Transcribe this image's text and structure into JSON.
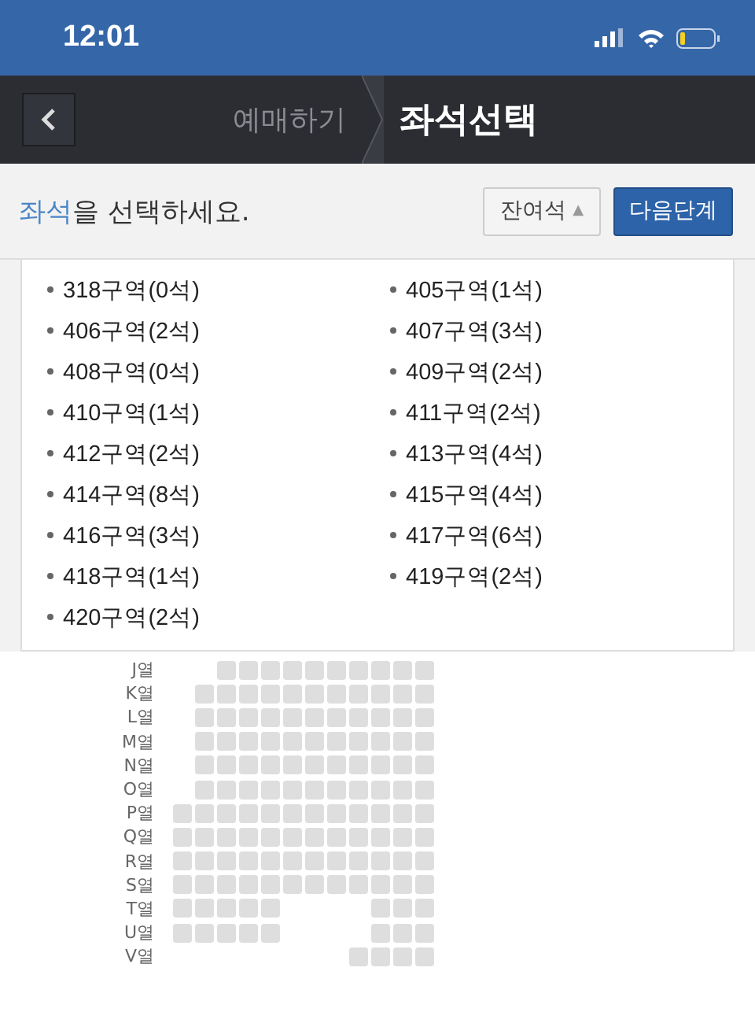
{
  "status_bar": {
    "time": "12:01"
  },
  "nav": {
    "steps": [
      {
        "label": "예매하기",
        "selected": false
      },
      {
        "label": "좌석선택",
        "selected": true
      }
    ]
  },
  "toolbar": {
    "prompt": "**좌석**을 선택하세요.",
    "sort_button": {
      "label": "잔여석",
      "arrow": "▲"
    },
    "next_button": "다음단계"
  },
  "sections": [
    "318구역(0석)",
    "405구역(1석)",
    "406구역(2석)",
    "407구역(3석)",
    "408구역(0석)",
    "409구역(2석)",
    "410구역(1석)",
    "411구역(2석)",
    "412구역(2석)",
    "413구역(4석)",
    "414구역(8석)",
    "415구역(4석)",
    "416구역(3석)",
    "417구역(6석)",
    "418구역(1석)",
    "419구역(2석)",
    "420구역(2석)"
  ],
  "seat_map": {
    "rows": [
      {
        "label": "J열",
        "seats": [
          {
            "kind": "gap"
          },
          {
            "kind": "gap"
          },
          {
            "kind": "seat"
          },
          {
            "kind": "seat"
          },
          {
            "kind": "seat"
          },
          {
            "kind": "seat"
          },
          {
            "kind": "seat"
          },
          {
            "kind": "seat"
          },
          {
            "kind": "seat"
          },
          {
            "kind": "seat"
          },
          {
            "kind": "seat"
          },
          {
            "kind": "seat"
          }
        ]
      },
      {
        "label": "K열",
        "seats": [
          {
            "kind": "gap"
          },
          {
            "kind": "seat"
          },
          {
            "kind": "seat"
          },
          {
            "kind": "seat"
          },
          {
            "kind": "seat"
          },
          {
            "kind": "seat"
          },
          {
            "kind": "seat"
          },
          {
            "kind": "seat"
          },
          {
            "kind": "seat"
          },
          {
            "kind": "seat"
          },
          {
            "kind": "seat"
          },
          {
            "kind": "seat"
          }
        ]
      },
      {
        "label": "L열",
        "seats": [
          {
            "kind": "gap"
          },
          {
            "kind": "seat"
          },
          {
            "kind": "seat"
          },
          {
            "kind": "seat"
          },
          {
            "kind": "seat"
          },
          {
            "kind": "seat"
          },
          {
            "kind": "seat"
          },
          {
            "kind": "seat"
          },
          {
            "kind": "seat"
          },
          {
            "kind": "seat"
          },
          {
            "kind": "seat"
          },
          {
            "kind": "seat"
          }
        ]
      },
      {
        "label": "M열",
        "seats": [
          {
            "kind": "gap"
          },
          {
            "kind": "seat"
          },
          {
            "kind": "seat"
          },
          {
            "kind": "seat"
          },
          {
            "kind": "seat"
          },
          {
            "kind": "seat"
          },
          {
            "kind": "seat"
          },
          {
            "kind": "seat"
          },
          {
            "kind": "seat"
          },
          {
            "kind": "seat"
          },
          {
            "kind": "seat"
          },
          {
            "kind": "seat"
          }
        ]
      },
      {
        "label": "N열",
        "seats": [
          {
            "kind": "gap"
          },
          {
            "kind": "seat"
          },
          {
            "kind": "seat"
          },
          {
            "kind": "seat"
          },
          {
            "kind": "seat"
          },
          {
            "kind": "seat"
          },
          {
            "kind": "seat"
          },
          {
            "kind": "seat"
          },
          {
            "kind": "seat"
          },
          {
            "kind": "seat"
          },
          {
            "kind": "seat"
          },
          {
            "kind": "seat"
          }
        ]
      },
      {
        "label": "O열",
        "seats": [
          {
            "kind": "gap"
          },
          {
            "kind": "seat"
          },
          {
            "kind": "seat"
          },
          {
            "kind": "seat"
          },
          {
            "kind": "seat"
          },
          {
            "kind": "seat"
          },
          {
            "kind": "seat"
          },
          {
            "kind": "seat"
          },
          {
            "kind": "seat"
          },
          {
            "kind": "seat"
          },
          {
            "kind": "seat"
          },
          {
            "kind": "seat"
          }
        ]
      },
      {
        "label": "P열",
        "seats": [
          {
            "kind": "seat"
          },
          {
            "kind": "seat"
          },
          {
            "kind": "seat"
          },
          {
            "kind": "seat"
          },
          {
            "kind": "seat"
          },
          {
            "kind": "seat"
          },
          {
            "kind": "seat"
          },
          {
            "kind": "seat"
          },
          {
            "kind": "seat"
          },
          {
            "kind": "seat"
          },
          {
            "kind": "seat"
          },
          {
            "kind": "seat"
          }
        ]
      },
      {
        "label": "Q열",
        "seats": [
          {
            "kind": "seat"
          },
          {
            "kind": "seat"
          },
          {
            "kind": "seat"
          },
          {
            "kind": "seat"
          },
          {
            "kind": "seat"
          },
          {
            "kind": "seat"
          },
          {
            "kind": "seat"
          },
          {
            "kind": "seat"
          },
          {
            "kind": "seat"
          },
          {
            "kind": "seat"
          },
          {
            "kind": "seat"
          },
          {
            "kind": "seat"
          }
        ]
      },
      {
        "label": "R열",
        "seats": [
          {
            "kind": "seat"
          },
          {
            "kind": "seat"
          },
          {
            "kind": "seat"
          },
          {
            "kind": "seat"
          },
          {
            "kind": "seat"
          },
          {
            "kind": "seat"
          },
          {
            "kind": "seat"
          },
          {
            "kind": "seat"
          },
          {
            "kind": "seat"
          },
          {
            "kind": "seat"
          },
          {
            "kind": "seat"
          },
          {
            "kind": "seat"
          }
        ]
      },
      {
        "label": "S열",
        "seats": [
          {
            "kind": "seat"
          },
          {
            "kind": "seat"
          },
          {
            "kind": "seat"
          },
          {
            "kind": "seat"
          },
          {
            "kind": "seat"
          },
          {
            "kind": "seat"
          },
          {
            "kind": "seat"
          },
          {
            "kind": "seat"
          },
          {
            "kind": "seat"
          },
          {
            "kind": "seat"
          },
          {
            "kind": "seat"
          },
          {
            "kind": "seat"
          }
        ]
      },
      {
        "label": "T열",
        "seats": [
          {
            "kind": "seat"
          },
          {
            "kind": "seat"
          },
          {
            "kind": "seat"
          },
          {
            "kind": "seat"
          },
          {
            "kind": "seat"
          },
          {
            "kind": "gap"
          },
          {
            "kind": "gap"
          },
          {
            "kind": "gap"
          },
          {
            "kind": "gap"
          },
          {
            "kind": "seat"
          },
          {
            "kind": "seat"
          },
          {
            "kind": "seat"
          }
        ]
      },
      {
        "label": "U열",
        "seats": [
          {
            "kind": "seat"
          },
          {
            "kind": "seat"
          },
          {
            "kind": "seat"
          },
          {
            "kind": "seat"
          },
          {
            "kind": "seat"
          },
          {
            "kind": "gap"
          },
          {
            "kind": "gap"
          },
          {
            "kind": "gap"
          },
          {
            "kind": "gap"
          },
          {
            "kind": "seat"
          },
          {
            "kind": "seat"
          },
          {
            "kind": "seat"
          }
        ]
      },
      {
        "label": "V열",
        "seats": [
          {
            "kind": "gap"
          },
          {
            "kind": "gap"
          },
          {
            "kind": "gap"
          },
          {
            "kind": "gap"
          },
          {
            "kind": "gap"
          },
          {
            "kind": "gap"
          },
          {
            "kind": "gap"
          },
          {
            "kind": "gap"
          },
          {
            "kind": "seat"
          },
          {
            "kind": "seat"
          },
          {
            "kind": "seat"
          },
          {
            "kind": "seat"
          }
        ]
      }
    ]
  }
}
